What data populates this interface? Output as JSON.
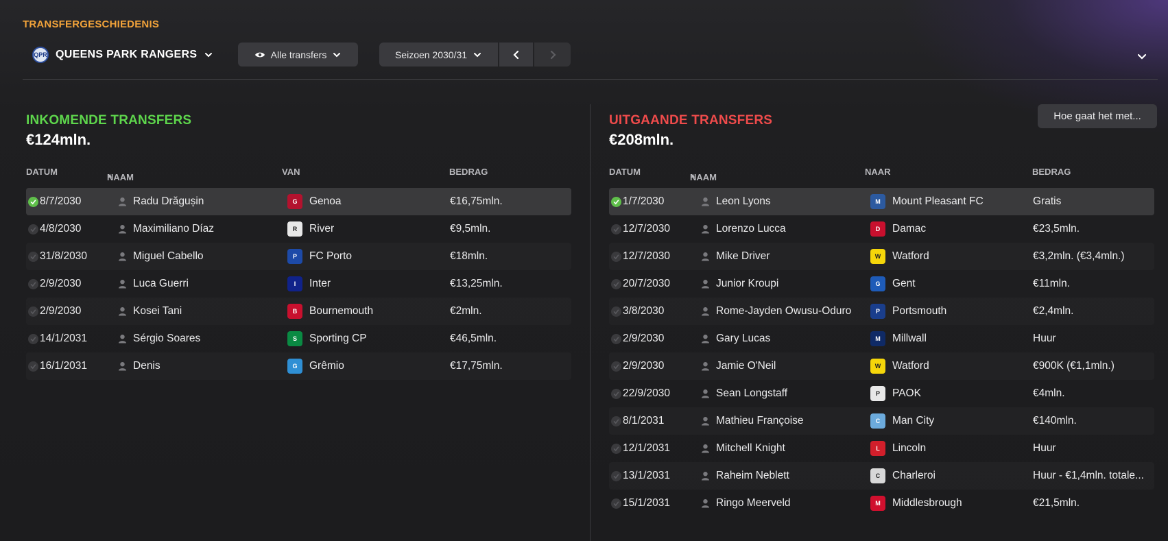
{
  "header": {
    "title": "TRANSFERGESCHIEDENIS",
    "club": {
      "name": "QUEENS PARK RANGERS",
      "crest_letters": "QPR"
    },
    "filter_label": "Alle transfers",
    "season_label": "Seizoen 2030/31"
  },
  "colors": {
    "incoming": "#5ed64c",
    "outgoing": "#ef4b4b",
    "accent": "#f2a33a"
  },
  "incoming": {
    "title": "INKOMENDE TRANSFERS",
    "total": "€124mln.",
    "columns": {
      "date": "DATUM",
      "name": "NAAM",
      "club": "VAN",
      "fee": "BEDRAG"
    },
    "rows": [
      {
        "date": "8/7/2030",
        "name": "Radu Drăgușin",
        "club": "Genoa",
        "fee": "€16,75mln.",
        "done": true,
        "crest_color": "#b3122e",
        "crest_text": "G"
      },
      {
        "date": "4/8/2030",
        "name": "Maximiliano Díaz",
        "club": "River",
        "fee": "€9,5mln.",
        "done": false,
        "crest_color": "#e8e8e8",
        "crest_text": "R"
      },
      {
        "date": "31/8/2030",
        "name": "Miguel Cabello",
        "club": "FC Porto",
        "fee": "€18mln.",
        "done": false,
        "crest_color": "#1d4aa8",
        "crest_text": "P"
      },
      {
        "date": "2/9/2030",
        "name": "Luca Guerri",
        "club": "Inter",
        "fee": "€13,25mln.",
        "done": false,
        "crest_color": "#10228a",
        "crest_text": "I"
      },
      {
        "date": "2/9/2030",
        "name": "Kosei Tani",
        "club": "Bournemouth",
        "fee": "€2mln.",
        "done": false,
        "crest_color": "#c8102e",
        "crest_text": "B"
      },
      {
        "date": "14/1/2031",
        "name": "Sérgio Soares",
        "club": "Sporting CP",
        "fee": "€46,5mln.",
        "done": false,
        "crest_color": "#0a8a43",
        "crest_text": "S"
      },
      {
        "date": "16/1/2031",
        "name": "Denis",
        "club": "Grêmio",
        "fee": "€17,75mln.",
        "done": false,
        "crest_color": "#2f8fd4",
        "crest_text": "G"
      }
    ]
  },
  "outgoing": {
    "title": "UITGAANDE TRANSFERS",
    "total": "€208mln.",
    "help_label": "Hoe gaat het met...",
    "columns": {
      "date": "DATUM",
      "name": "NAAM",
      "club": "NAAR",
      "fee": "BEDRAG"
    },
    "rows": [
      {
        "date": "1/7/2030",
        "name": "Leon Lyons",
        "club": "Mount Pleasant FC",
        "fee": "Gratis",
        "done": true,
        "crest_color": "#2c5aa0",
        "crest_text": "M"
      },
      {
        "date": "12/7/2030",
        "name": "Lorenzo Lucca",
        "club": "Damac",
        "fee": "€23,5mln.",
        "done": false,
        "crest_color": "#c8102e",
        "crest_text": "D"
      },
      {
        "date": "12/7/2030",
        "name": "Mike Driver",
        "club": "Watford",
        "fee": "€3,2mln. (€3,4mln.)",
        "done": false,
        "crest_color": "#f5d60a",
        "crest_text": "W"
      },
      {
        "date": "20/7/2030",
        "name": "Junior Kroupi",
        "club": "Gent",
        "fee": "€11mln.",
        "done": false,
        "crest_color": "#1e5bb8",
        "crest_text": "G"
      },
      {
        "date": "3/8/2030",
        "name": "Rome-Jayden Owusu-Oduro",
        "club": "Portsmouth",
        "fee": "€2,4mln.",
        "done": false,
        "crest_color": "#1a3e8c",
        "crest_text": "P"
      },
      {
        "date": "2/9/2030",
        "name": "Gary Lucas",
        "club": "Millwall",
        "fee": "Huur",
        "done": false,
        "crest_color": "#0f2a66",
        "crest_text": "M"
      },
      {
        "date": "2/9/2030",
        "name": "Jamie O'Neil",
        "club": "Watford",
        "fee": "€900K (€1,1mln.)",
        "done": false,
        "crest_color": "#f5d60a",
        "crest_text": "W"
      },
      {
        "date": "22/9/2030",
        "name": "Sean Longstaff",
        "club": "PAOK",
        "fee": "€4mln.",
        "done": false,
        "crest_color": "#e8e8e8",
        "crest_text": "P"
      },
      {
        "date": "8/1/2031",
        "name": "Mathieu Françoise",
        "club": "Man City",
        "fee": "€140mln.",
        "done": false,
        "crest_color": "#6cabdd",
        "crest_text": "C"
      },
      {
        "date": "12/1/2031",
        "name": "Mitchell Knight",
        "club": "Lincoln",
        "fee": "Huur",
        "done": false,
        "crest_color": "#d21f2b",
        "crest_text": "L"
      },
      {
        "date": "13/1/2031",
        "name": "Raheim Neblett",
        "club": "Charleroi",
        "fee": "Huur - €1,4mln. totale...",
        "done": false,
        "crest_color": "#d8d8d8",
        "crest_text": "C"
      },
      {
        "date": "15/1/2031",
        "name": "Ringo Meerveld",
        "club": "Middlesbrough",
        "fee": "€21,5mln.",
        "done": false,
        "crest_color": "#d0102e",
        "crest_text": "M"
      }
    ]
  }
}
